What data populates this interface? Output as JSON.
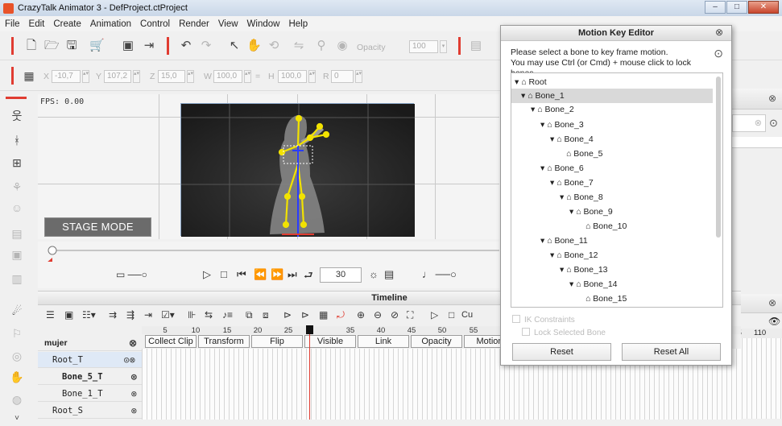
{
  "window": {
    "title": "CrazyTalk Animator 3  - DefProject.ctProject",
    "min": "–",
    "max": "□",
    "close": "✕"
  },
  "menu": [
    "File",
    "Edit",
    "Create",
    "Animation",
    "Control",
    "Render",
    "View",
    "Window",
    "Help"
  ],
  "toolbar": {
    "opacity_label": "Opacity",
    "opacity_value": "100"
  },
  "transform": {
    "x_label": "X",
    "x_value": "-10,7",
    "y_label": "Y",
    "y_value": "107,2",
    "z_label": "Z",
    "z_value": "15,0",
    "w_label": "W",
    "w_value": "100,0",
    "eq": "=",
    "h_label": "H",
    "h_value": "100,0",
    "r_label": "R",
    "r_value": "0"
  },
  "viewport": {
    "fps": "FPS: 0.00",
    "stage_mode": "STAGE MODE"
  },
  "playback": {
    "frame": "30"
  },
  "timeline": {
    "title": "Timeline",
    "cur_label": "Cu",
    "ruler": [
      "5",
      "10",
      "15",
      "20",
      "25",
      "35",
      "40",
      "45",
      "50",
      "55",
      "60",
      "105",
      "110"
    ],
    "columns": [
      "Collect Clip",
      "Transform",
      "Flip",
      "Visible",
      "Link",
      "Opacity",
      "Motion"
    ],
    "object_name": "mujer",
    "tracks": [
      "Root_T",
      "Bone_5_T",
      "Bone_1_T",
      "Root_S"
    ]
  },
  "mke": {
    "title": "Motion Key Editor",
    "info_line1": "Please select a bone to key frame motion.",
    "info_line2": "You may use Ctrl (or Cmd) + mouse click to lock bones.",
    "tree": [
      "Root",
      "Bone_1",
      "Bone_2",
      "Bone_3",
      "Bone_4",
      "Bone_5",
      "Bone_6",
      "Bone_7",
      "Bone_8",
      "Bone_9",
      "Bone_10",
      "Bone_11",
      "Bone_12",
      "Bone_13",
      "Bone_14",
      "Bone_15"
    ],
    "ik_label": "IK Constraints",
    "lock_label": "Lock Selected Bone",
    "reset": "Reset",
    "reset_all": "Reset All"
  },
  "colors": {
    "accent": "#e03c31",
    "bone": "#f2e200",
    "selection": "#d9d9d9"
  }
}
